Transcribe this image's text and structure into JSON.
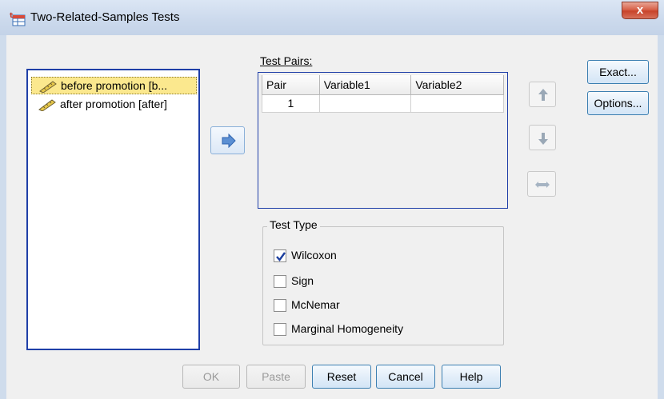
{
  "window": {
    "title": "Two-Related-Samples Tests",
    "close_label": "x"
  },
  "variables": [
    {
      "label": "before promotion [b...",
      "selected": true,
      "icon": "ruler-icon"
    },
    {
      "label": "after promotion [after]",
      "selected": false,
      "icon": "ruler-icon"
    }
  ],
  "test_pairs": {
    "label": "Test Pairs:",
    "columns": [
      "Pair",
      "Variable1",
      "Variable2"
    ],
    "rows": [
      {
        "pair": "1",
        "variable1": "",
        "variable2": ""
      }
    ]
  },
  "test_type": {
    "legend": "Test Type",
    "options": [
      {
        "label": "Wilcoxon",
        "checked": true
      },
      {
        "label": "Sign",
        "checked": false
      },
      {
        "label": "McNemar",
        "checked": false
      },
      {
        "label": "Marginal Homogeneity",
        "checked": false
      }
    ]
  },
  "side_buttons": {
    "exact": "Exact...",
    "options": "Options..."
  },
  "bottom_buttons": {
    "ok": "OK",
    "paste": "Paste",
    "reset": "Reset",
    "cancel": "Cancel",
    "help": "Help"
  },
  "colors": {
    "selection": "#fbe88e",
    "list_border": "#1f3fa8",
    "button_border": "#3c7fb1",
    "arrow_blue": "#5b8fd3"
  }
}
